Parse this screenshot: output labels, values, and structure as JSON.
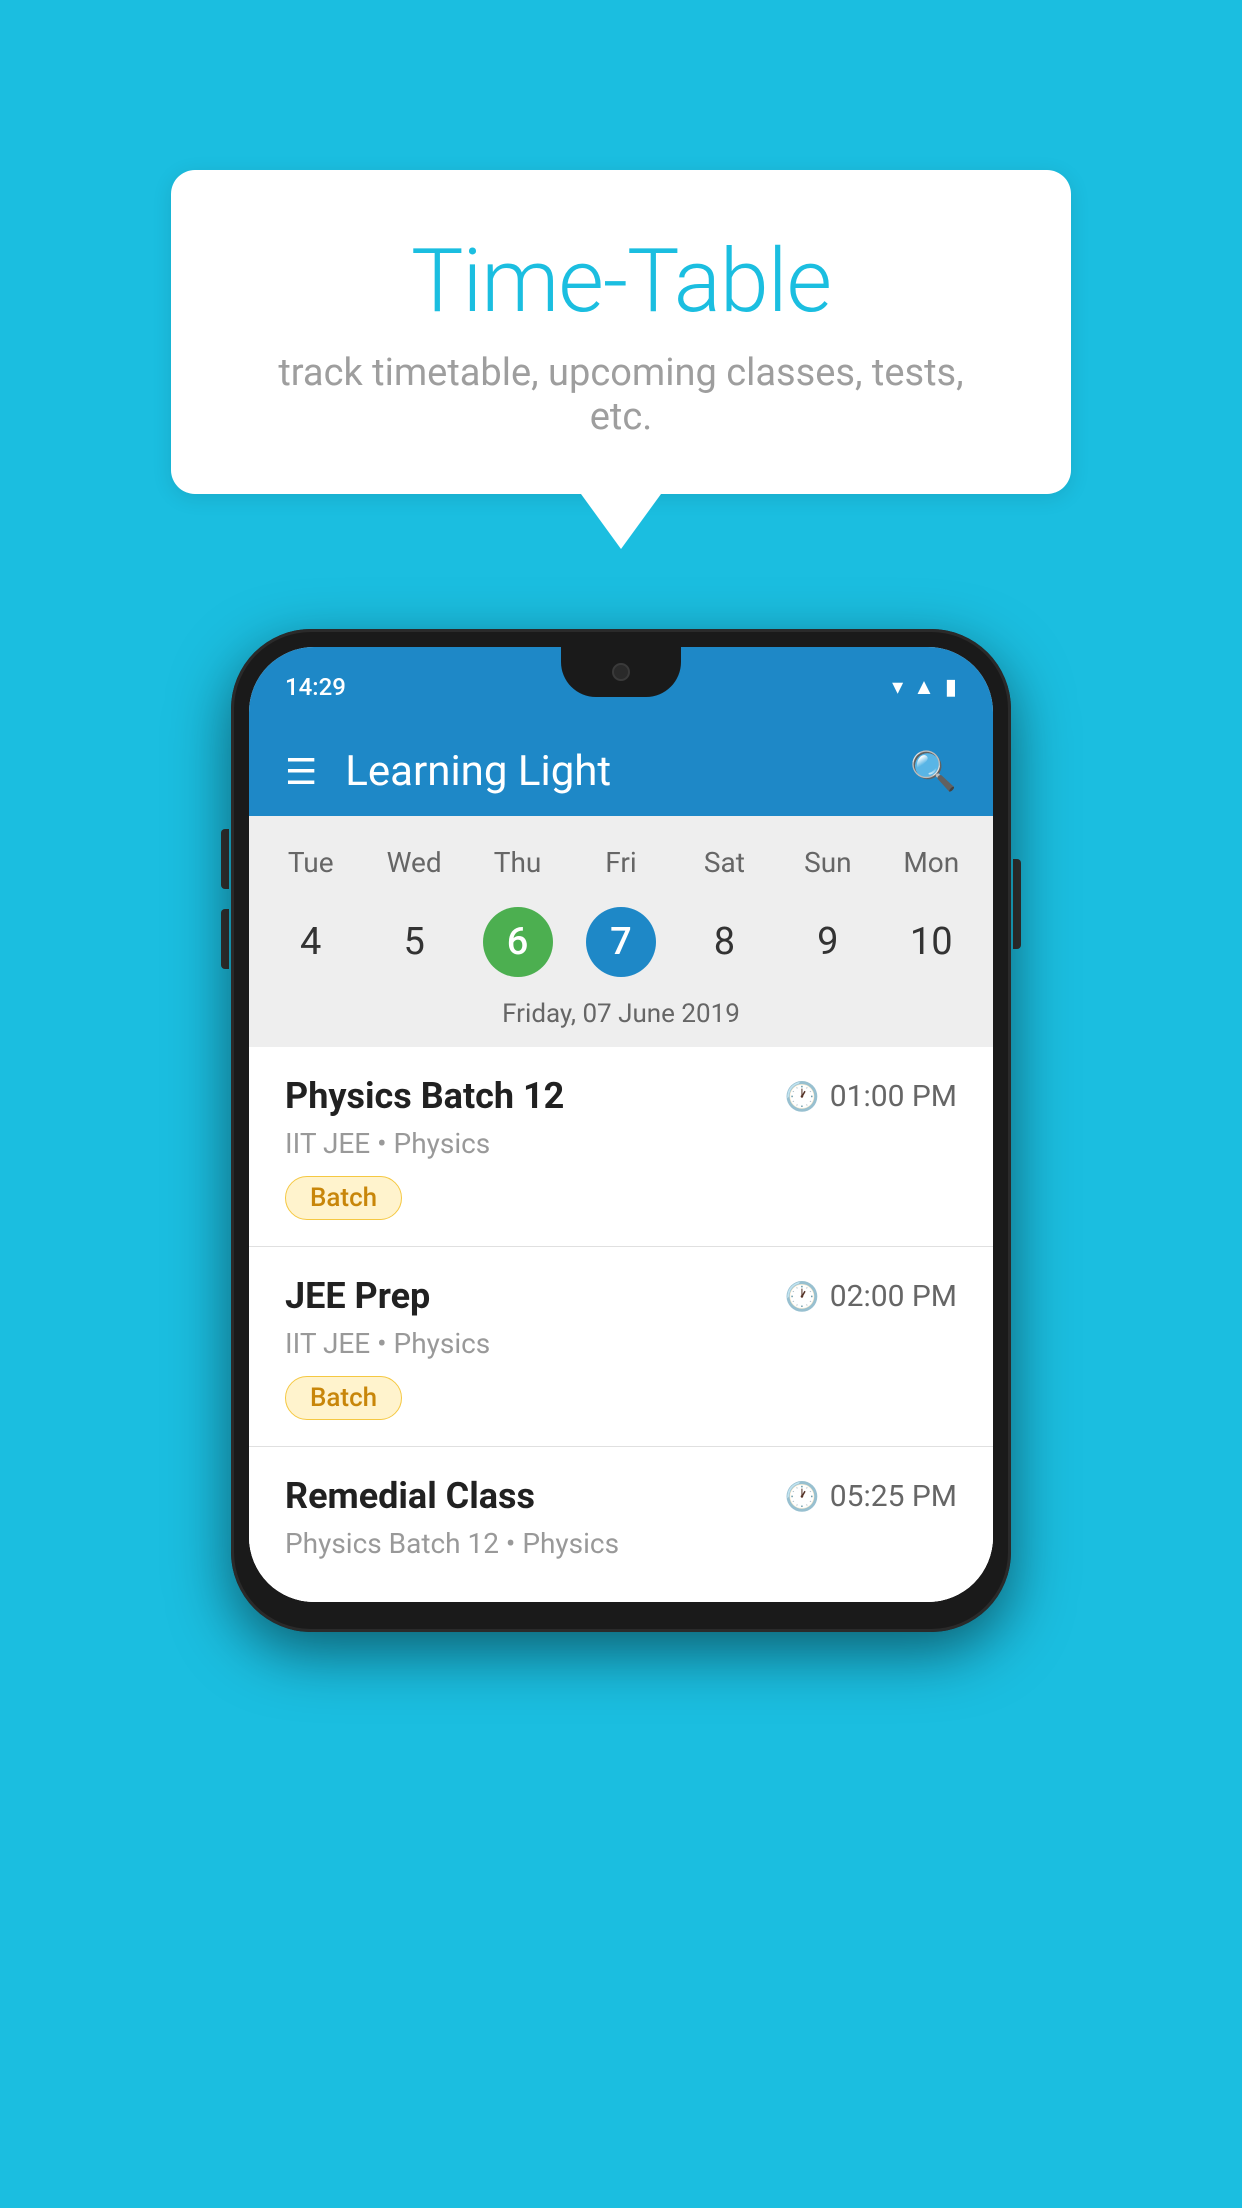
{
  "background_color": "#1BBEE0",
  "speech_bubble": {
    "title": "Time-Table",
    "subtitle": "track timetable, upcoming classes, tests, etc."
  },
  "phone": {
    "status_bar": {
      "time": "14:29",
      "icons": [
        "wifi",
        "signal",
        "battery"
      ]
    },
    "app_header": {
      "title": "Learning Light"
    },
    "calendar": {
      "days": [
        "Tue",
        "Wed",
        "Thu",
        "Fri",
        "Sat",
        "Sun",
        "Mon"
      ],
      "dates": [
        "4",
        "5",
        "6",
        "7",
        "8",
        "9",
        "10"
      ],
      "today_index": 2,
      "selected_index": 3,
      "selected_date_label": "Friday, 07 June 2019"
    },
    "classes": [
      {
        "name": "Physics Batch 12",
        "time": "01:00 PM",
        "meta": "IIT JEE • Physics",
        "tag": "Batch"
      },
      {
        "name": "JEE Prep",
        "time": "02:00 PM",
        "meta": "IIT JEE • Physics",
        "tag": "Batch"
      },
      {
        "name": "Remedial Class",
        "time": "05:25 PM",
        "meta": "Physics Batch 12 • Physics",
        "tag": ""
      }
    ]
  }
}
